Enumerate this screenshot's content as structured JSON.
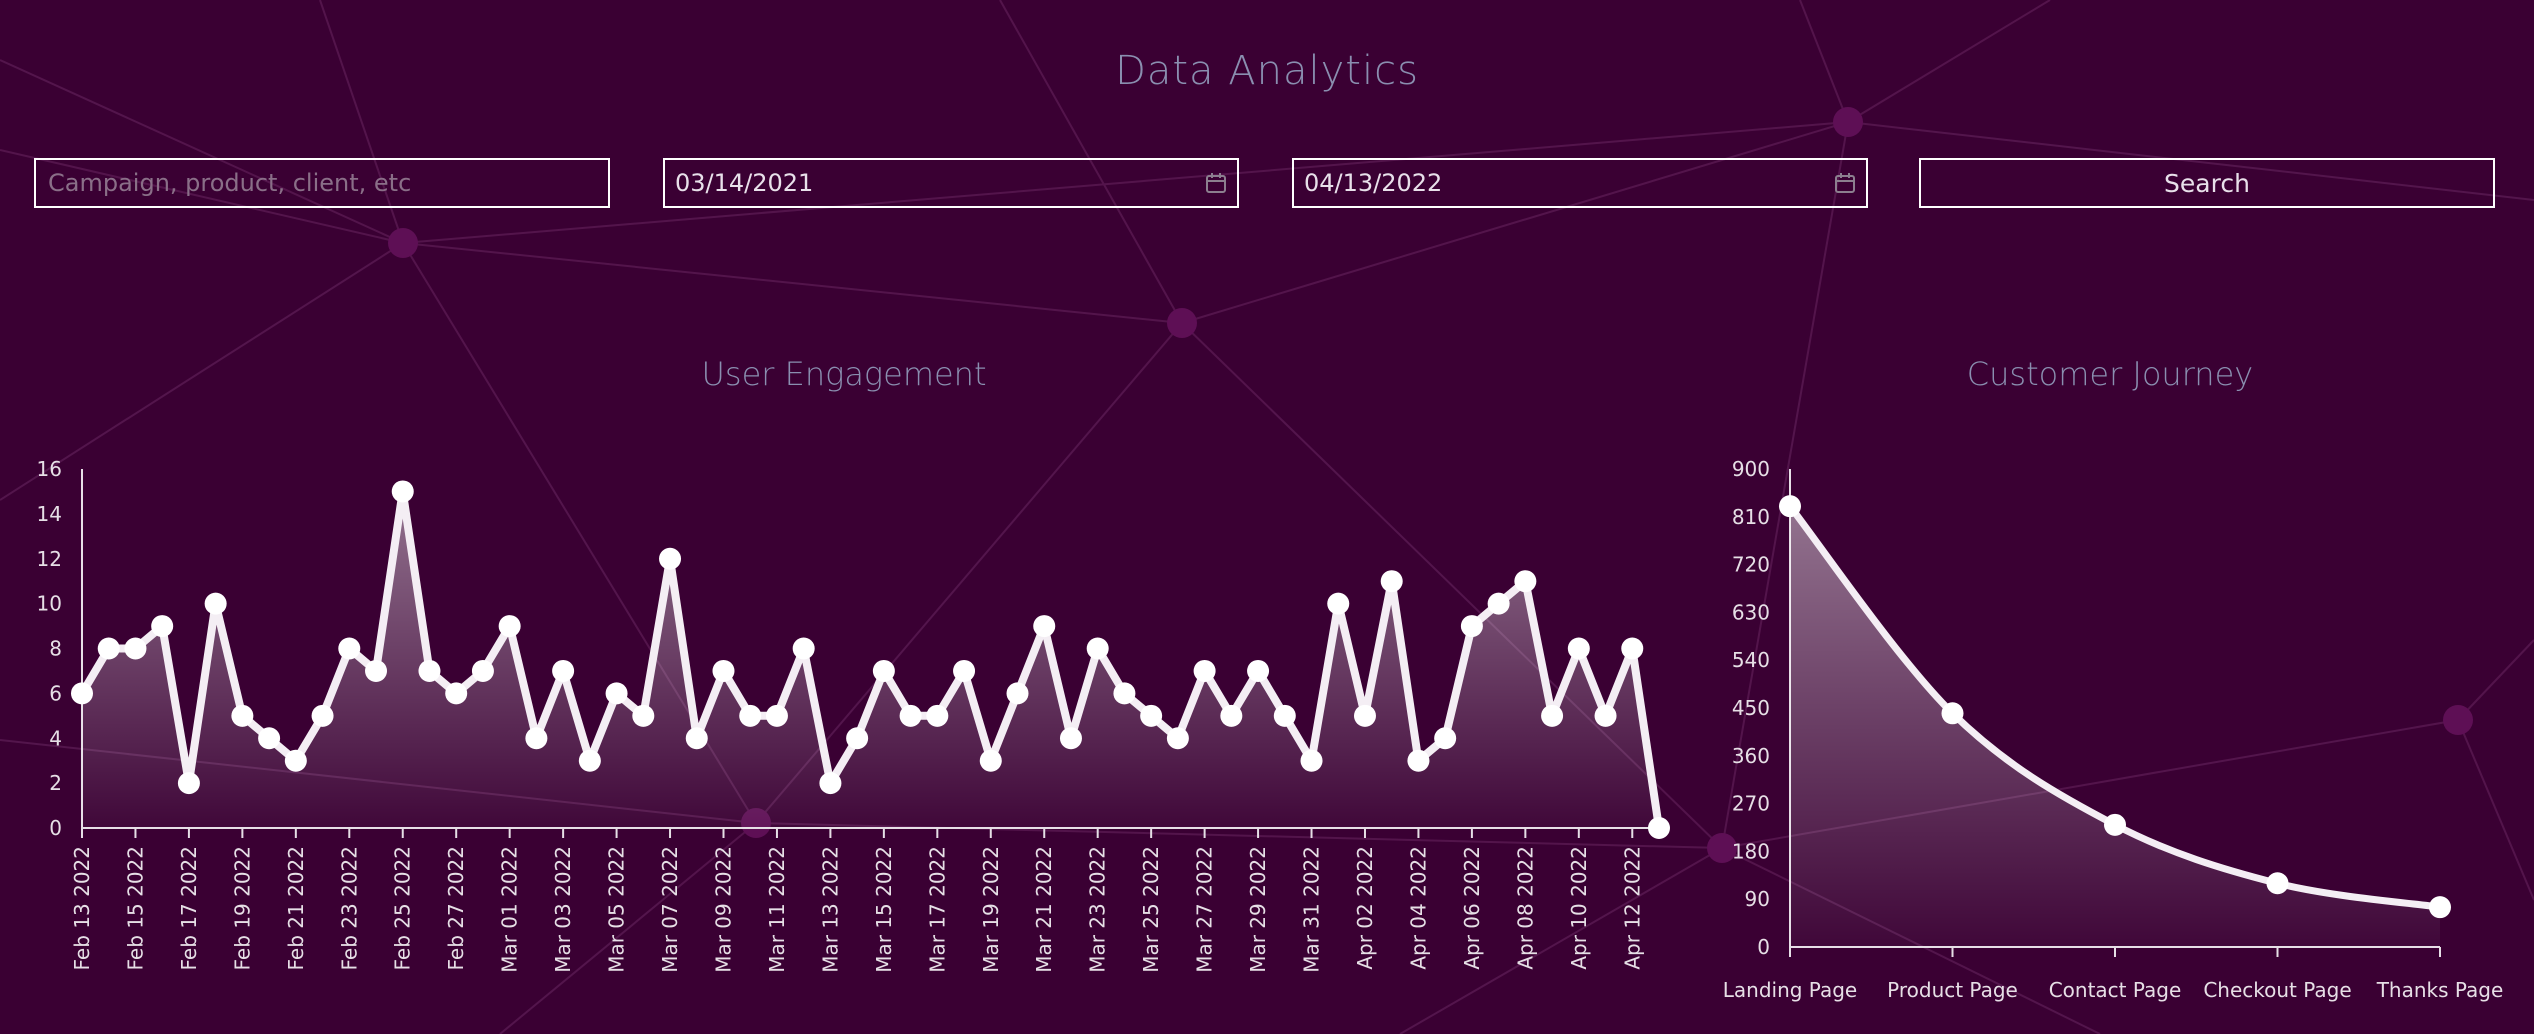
{
  "page": {
    "title": "Data Analytics"
  },
  "search": {
    "placeholder": "Campaign, product, client, etc",
    "start_date": "03/14/2021",
    "end_date": "04/13/2022",
    "button_label": "Search"
  },
  "colors": {
    "background": "#3a0033",
    "line": "#f4eef4",
    "title": "#8a8fb0"
  },
  "chart_data": [
    {
      "type": "area",
      "title": "User Engagement",
      "ylim": [
        0,
        16
      ],
      "yticks": [
        0,
        2,
        4,
        6,
        8,
        10,
        12,
        14,
        16
      ],
      "x": [
        "Feb 13 2022",
        "Feb 14 2022",
        "Feb 15 2022",
        "Feb 16 2022",
        "Feb 17 2022",
        "Feb 18 2022",
        "Feb 19 2022",
        "Feb 20 2022",
        "Feb 21 2022",
        "Feb 22 2022",
        "Feb 23 2022",
        "Feb 24 2022",
        "Feb 25 2022",
        "Feb 26 2022",
        "Feb 27 2022",
        "Feb 28 2022",
        "Mar 01 2022",
        "Mar 02 2022",
        "Mar 03 2022",
        "Mar 04 2022",
        "Mar 05 2022",
        "Mar 06 2022",
        "Mar 07 2022",
        "Mar 08 2022",
        "Mar 09 2022",
        "Mar 10 2022",
        "Mar 11 2022",
        "Mar 12 2022",
        "Mar 13 2022",
        "Mar 14 2022",
        "Mar 15 2022",
        "Mar 16 2022",
        "Mar 17 2022",
        "Mar 18 2022",
        "Mar 19 2022",
        "Mar 20 2022",
        "Mar 21 2022",
        "Mar 22 2022",
        "Mar 23 2022",
        "Mar 24 2022",
        "Mar 25 2022",
        "Mar 26 2022",
        "Mar 27 2022",
        "Mar 28 2022",
        "Mar 29 2022",
        "Mar 30 2022",
        "Mar 31 2022",
        "Apr 01 2022",
        "Apr 02 2022",
        "Apr 03 2022",
        "Apr 04 2022",
        "Apr 05 2022",
        "Apr 06 2022",
        "Apr 07 2022",
        "Apr 08 2022",
        "Apr 09 2022",
        "Apr 10 2022",
        "Apr 11 2022",
        "Apr 12 2022",
        "Apr 13 2022"
      ],
      "values": [
        6,
        8,
        8,
        9,
        2,
        10,
        5,
        4,
        3,
        5,
        8,
        7,
        15,
        7,
        6,
        7,
        9,
        4,
        7,
        3,
        6,
        5,
        12,
        4,
        7,
        5,
        5,
        8,
        2,
        4,
        7,
        5,
        5,
        7,
        3,
        6,
        9,
        4,
        8,
        6,
        5,
        4,
        7,
        5,
        7,
        5,
        3,
        10,
        5,
        11,
        3,
        4,
        9,
        10,
        11,
        5,
        8,
        5,
        8,
        0
      ],
      "xtick_labels": [
        "Feb 13 2022",
        "Feb 15 2022",
        "Feb 17 2022",
        "Feb 19 2022",
        "Feb 21 2022",
        "Feb 23 2022",
        "Feb 25 2022",
        "Feb 27 2022",
        "Mar 01 2022",
        "Mar 03 2022",
        "Mar 05 2022",
        "Mar 07 2022",
        "Mar 09 2022",
        "Mar 11 2022",
        "Mar 13 2022",
        "Mar 15 2022",
        "Mar 17 2022",
        "Mar 19 2022",
        "Mar 21 2022",
        "Mar 23 2022",
        "Mar 25 2022",
        "Mar 27 2022",
        "Mar 29 2022",
        "Mar 31 2022",
        "Apr 02 2022",
        "Apr 04 2022",
        "Apr 06 2022",
        "Apr 08 2022",
        "Apr 10 2022",
        "Apr 12 2022"
      ]
    },
    {
      "type": "area",
      "title": "Customer Journey",
      "ylim": [
        0,
        900
      ],
      "yticks": [
        0,
        90,
        180,
        270,
        360,
        450,
        540,
        630,
        720,
        810,
        900
      ],
      "categories": [
        "Landing Page",
        "Product Page",
        "Contact Page",
        "Checkout Page",
        "Thanks Page"
      ],
      "values": [
        830,
        440,
        230,
        120,
        75
      ]
    }
  ]
}
